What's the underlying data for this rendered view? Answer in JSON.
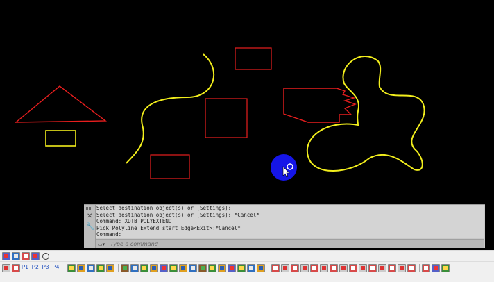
{
  "command_panel": {
    "history": [
      "Select destination object(s) or [Settings]:",
      "Select destination object(s) or [Settings]: *Cancel*",
      "Command: XDTB_POLYEXTEND",
      "Pick Polyline Extend start Edge<Exit>:*Cancel*",
      "Command:"
    ],
    "input_placeholder": "Type a command"
  },
  "toolbar_bottom": {
    "p1": "P1",
    "p2": "P2",
    "p3": "P3",
    "p4": "P4"
  },
  "colors": {
    "background": "#000000",
    "red": "#e81e1e",
    "yellow": "#f2ee1c",
    "cursor_highlight": "#1515e8"
  },
  "icons": [
    "layer-icon",
    "zoom-icon",
    "p1-icon",
    "p2-icon",
    "p3-icon",
    "p4-icon"
  ]
}
